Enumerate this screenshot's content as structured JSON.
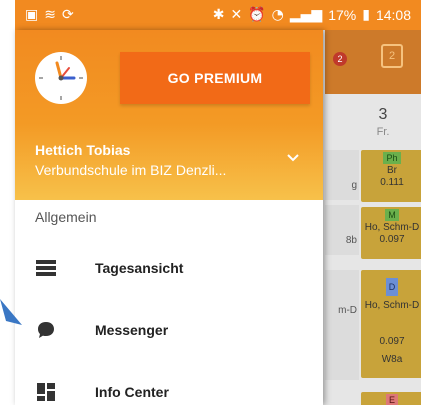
{
  "status_bar": {
    "bluetooth": "✱",
    "battery": "17%",
    "time": "14:08"
  },
  "background_app": {
    "badge": "2",
    "calendar_day": "2",
    "day_number": "3",
    "day_abbr": "Fr.",
    "cells": [
      {
        "subject": "Ph",
        "teacher": "Br",
        "room": "0.111"
      },
      {
        "subject": "M",
        "teacher": "Ho, Schm-D",
        "room": "0.097"
      },
      {
        "subject": "D",
        "teacher": "Ho, Schm-D",
        "room": "0.097",
        "class": "W8a"
      },
      {
        "subject": "E"
      }
    ],
    "side_fragments": [
      "g",
      "8b",
      "m-D"
    ]
  },
  "drawer": {
    "premium_button": "GO PREMIUM",
    "user_name": "Hettich Tobias",
    "user_school": "Verbundschule im BIZ Denzli...",
    "section_label": "Allgemein",
    "menu": [
      {
        "label": "Tagesansicht",
        "icon": "day-view-icon"
      },
      {
        "label": "Messenger",
        "icon": "chat-bubble-icon"
      },
      {
        "label": "Info Center",
        "icon": "dashboard-icon"
      }
    ]
  },
  "colors": {
    "status_bar": "#f28a20",
    "premium_button": "#f26a17",
    "header_gradient_end": "#f7c14a",
    "arrow": "#3a77c4"
  }
}
